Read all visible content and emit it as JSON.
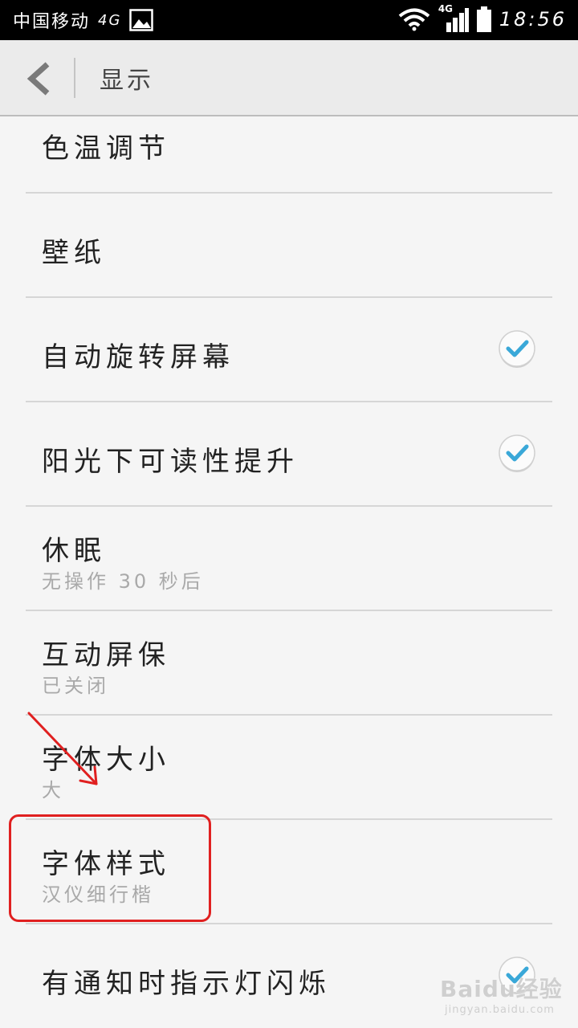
{
  "status_bar": {
    "carrier": "中国移动",
    "network": "4G",
    "signal_network": "4G",
    "time": "18:56"
  },
  "toolbar": {
    "title": "显示"
  },
  "settings": [
    {
      "title": "色温调节",
      "subtitle": "",
      "checked": false
    },
    {
      "title": "壁纸",
      "subtitle": "",
      "checked": false
    },
    {
      "title": "自动旋转屏幕",
      "subtitle": "",
      "checked": true
    },
    {
      "title": "阳光下可读性提升",
      "subtitle": "",
      "checked": true
    },
    {
      "title": "休眠",
      "subtitle": "无操作 30 秒后",
      "checked": false
    },
    {
      "title": "互动屏保",
      "subtitle": "已关闭",
      "checked": false
    },
    {
      "title": "字体大小",
      "subtitle": "大",
      "checked": false
    },
    {
      "title": "字体样式",
      "subtitle": "汉仪细行楷",
      "checked": false
    },
    {
      "title": "有通知时指示灯闪烁",
      "subtitle": "",
      "checked": true
    }
  ],
  "watermark": {
    "main": "Baidu经验",
    "sub": "jingyan.baidu.com"
  },
  "colors": {
    "status_bar_bg": "#000000",
    "toolbar_bg": "#ebebeb",
    "list_bg": "#f5f5f5",
    "check_accent": "#3aa8d8",
    "annotation_red": "#e02020"
  }
}
